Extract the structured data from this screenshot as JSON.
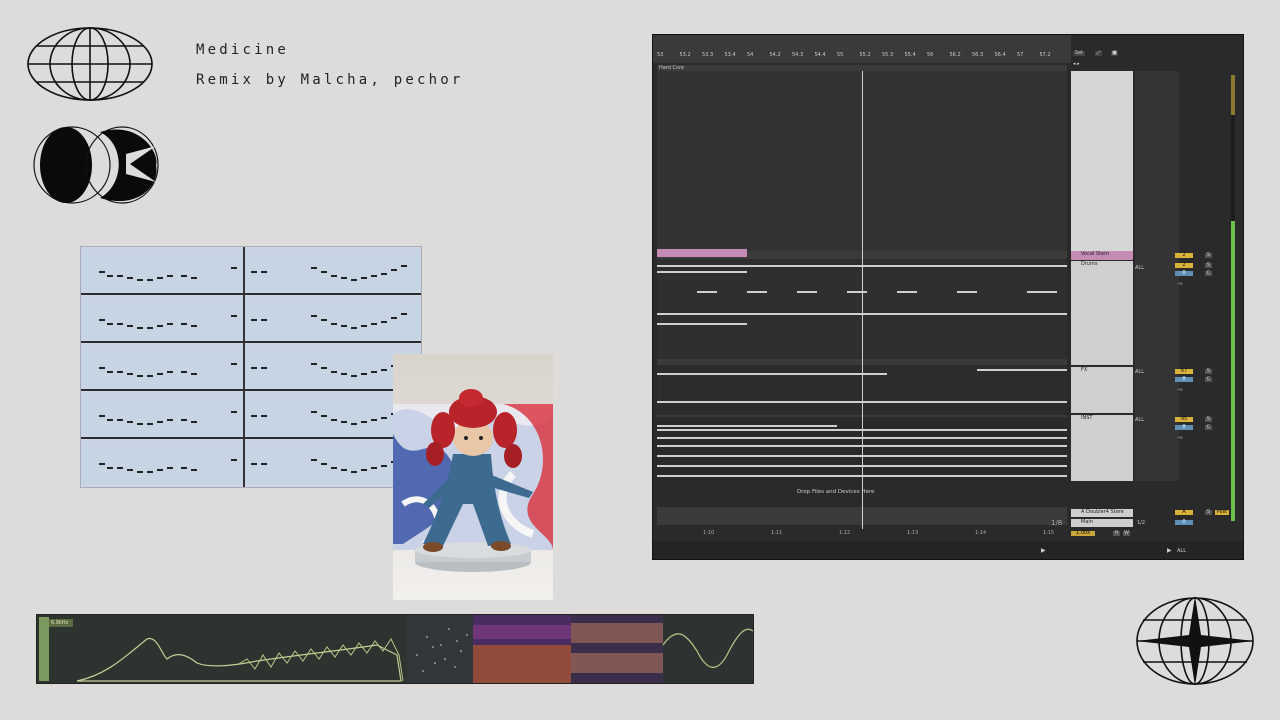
{
  "header": {
    "title": "Medicine",
    "subtitle": "Remix by Malcha, pechor"
  },
  "daw": {
    "ruler_ticks": [
      "53",
      "53.2",
      "53.3",
      "53.4",
      "54",
      "54.2",
      "54.3",
      "54.4",
      "55",
      "55.2",
      "55.3",
      "55.4",
      "56",
      "56.2",
      "56.3",
      "56.4",
      "57",
      "57.2"
    ],
    "set_label": "Set",
    "group_label": "Hard Core",
    "tracks": [
      {
        "name": "Vocal Stem",
        "volume": "2",
        "solo": "S",
        "input": ""
      },
      {
        "name": "Drums",
        "volume": "2",
        "solo": "S",
        "input": "ALL",
        "pan": "0",
        "c": "C",
        "db": "-∞"
      },
      {
        "name": "FX",
        "volume": "67",
        "solo": "S",
        "input": "ALL",
        "pan": "0",
        "c": "C",
        "db": "-∞"
      },
      {
        "name": "INST",
        "volume": "95",
        "solo": "S",
        "input": "ALL",
        "pan": "0",
        "c": "C",
        "db": "-∞"
      }
    ],
    "drop_text": "Drop Files and Devices Here",
    "return_track": {
      "name": "A Doubler4 Stere",
      "label": "A",
      "solo": "S",
      "post": "Post"
    },
    "main_track": {
      "name": "Main",
      "routing": "1/2",
      "value": "0"
    },
    "bottom_ticks": [
      "1:10",
      "1:11",
      "1:12",
      "1:13",
      "1:14",
      "1:15"
    ],
    "zoom": "1/8",
    "tempo": "1.00x",
    "hw": [
      "H",
      "W"
    ],
    "transport_all": "ALL"
  },
  "strip": {
    "label": "6.9kHz"
  },
  "colors": {
    "background": "#dedbdb",
    "daw_bg": "#2a2a2a",
    "accent_yellow": "#d9b23a",
    "meter_green": "#6fc04a",
    "vocal_clip": "#c48bb5"
  },
  "icons": [
    "globe-icon",
    "double-circle-logo-icon",
    "compass-globe-icon"
  ]
}
